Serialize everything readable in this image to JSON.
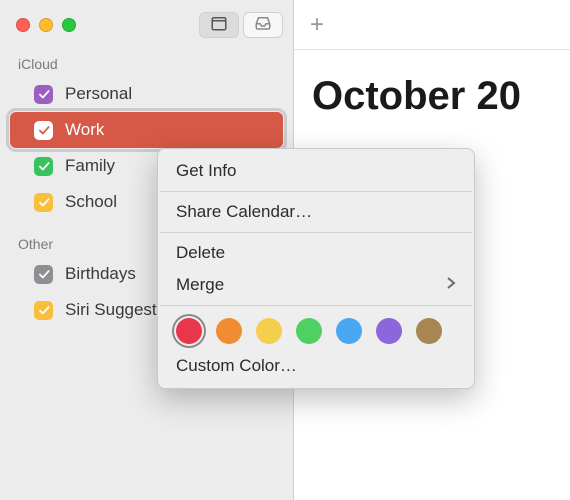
{
  "sidebar": {
    "sections": [
      {
        "title": "iCloud",
        "items": [
          {
            "label": "Personal",
            "color": "#9a5fc0",
            "checked": true,
            "selected": false
          },
          {
            "label": "Work",
            "color": "#ffffff",
            "checked": true,
            "selected": true
          },
          {
            "label": "Family",
            "color": "#39c360",
            "checked": true,
            "selected": false
          },
          {
            "label": "School",
            "color": "#f7bf3a",
            "checked": true,
            "selected": false
          }
        ]
      },
      {
        "title": "Other",
        "items": [
          {
            "label": "Birthdays",
            "color": "#8e8e93",
            "checked": true,
            "selected": false
          },
          {
            "label": "Siri Suggestions",
            "color": "#f7bf3a",
            "checked": true,
            "selected": false
          }
        ]
      }
    ]
  },
  "main": {
    "month_title": "October 20"
  },
  "context_menu": {
    "get_info": "Get Info",
    "share": "Share Calendar…",
    "delete": "Delete",
    "merge": "Merge",
    "custom_color": "Custom Color…",
    "colors": [
      {
        "hex": "#e8364b",
        "selected": true
      },
      {
        "hex": "#f08d33",
        "selected": false
      },
      {
        "hex": "#f4cf4e",
        "selected": false
      },
      {
        "hex": "#4fd062",
        "selected": false
      },
      {
        "hex": "#4aa8f2",
        "selected": false
      },
      {
        "hex": "#8c66da",
        "selected": false
      },
      {
        "hex": "#a78654",
        "selected": false
      }
    ]
  }
}
